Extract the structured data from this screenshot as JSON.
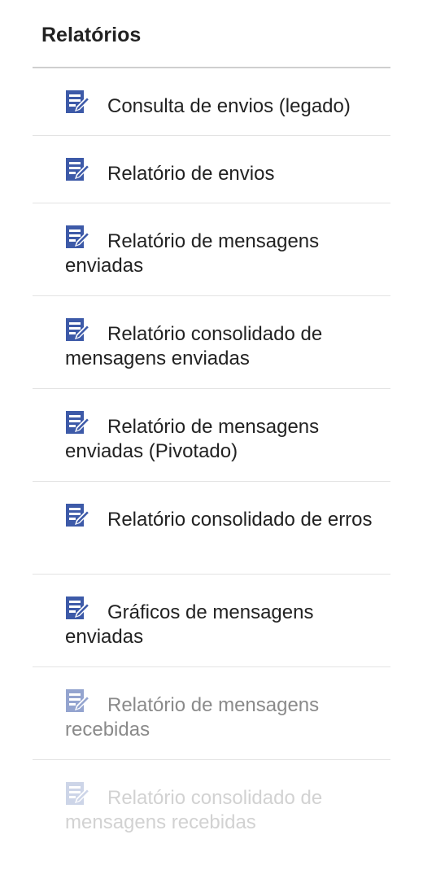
{
  "panel": {
    "title": "Relatórios"
  },
  "menu": {
    "items": [
      {
        "label": "Consulta de envios (legado)",
        "icon": "edit-document-icon"
      },
      {
        "label": "Relatório de envios",
        "icon": "edit-document-icon"
      },
      {
        "label": "Relatório de mensagens enviadas",
        "icon": "edit-document-icon"
      },
      {
        "label": "Relatório consolidado de mensagens enviadas",
        "icon": "edit-document-icon"
      },
      {
        "label": "Relatório de mensagens enviadas (Pivotado)",
        "icon": "edit-document-icon"
      },
      {
        "label": "Relatório consolidado de erros",
        "icon": "edit-document-icon"
      },
      {
        "label": "Gráficos de mensagens enviadas",
        "icon": "edit-document-icon"
      },
      {
        "label": "Relatório de mensagens recebidas",
        "icon": "edit-document-icon"
      },
      {
        "label": "Relatório consolidado de mensagens recebidas",
        "icon": "edit-document-icon"
      }
    ]
  },
  "colors": {
    "icon": "#3d5aa8",
    "text": "#222222",
    "divider": "#e3e3e3"
  }
}
